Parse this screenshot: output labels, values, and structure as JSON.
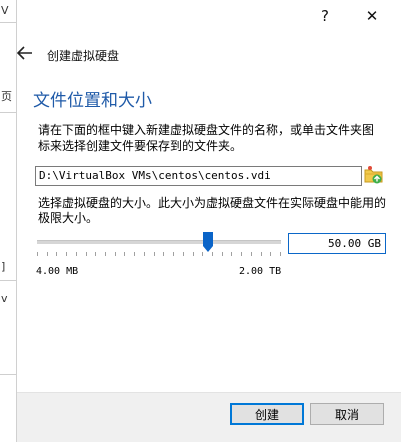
{
  "background": {
    "left_fragments": [
      "V",
      "页",
      "]",
      "v"
    ]
  },
  "titlebar": {
    "help_label": "?",
    "close_label": "✕"
  },
  "header": {
    "back_icon": "back-arrow-icon",
    "title": "创建虚拟硬盘"
  },
  "section": {
    "title": "文件位置和大小",
    "description": "请在下面的框中键入新建虚拟硬盘文件的名称，或单击文件夹图标来选择创建文件要保存到的文件夹。"
  },
  "file": {
    "path_value": "D:\\VirtualBox VMs\\centos\\centos.vdi",
    "folder_icon": "folder-browse-icon"
  },
  "size": {
    "description": "选择虚拟硬盘的大小。此大小为虚拟硬盘文件在实际硬盘中能用的极限大小。",
    "slider_fraction": 0.71,
    "min_label": "4.00 MB",
    "max_label": "2.00 TB",
    "value": "50.00 GB"
  },
  "footer": {
    "create_label": "创建",
    "cancel_label": "取消"
  },
  "colors": {
    "accent": "#0078d7",
    "title_blue": "#1f5aa8",
    "handle": "#0a64c8"
  }
}
